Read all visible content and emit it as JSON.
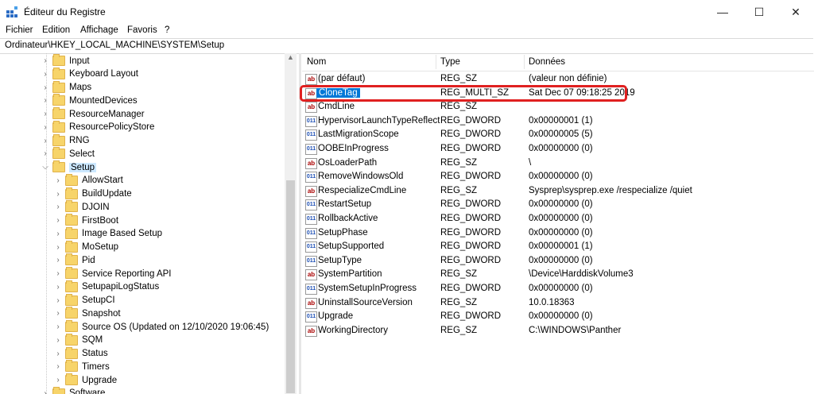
{
  "window": {
    "title": "Éditeur du Registre",
    "minimize_symbol": "—",
    "maximize_symbol": "☐",
    "close_symbol": "✕"
  },
  "menu": [
    "Fichier",
    "Edition",
    "Affichage",
    "Favoris",
    "?"
  ],
  "address": "Ordinateur\\HKEY_LOCAL_MACHINE\\SYSTEM\\Setup",
  "tree": {
    "items": [
      {
        "label": "Input",
        "level": 0,
        "expanded": false
      },
      {
        "label": "Keyboard Layout",
        "level": 0,
        "expanded": false
      },
      {
        "label": "Maps",
        "level": 0,
        "expanded": false
      },
      {
        "label": "MountedDevices",
        "level": 0,
        "expanded": false
      },
      {
        "label": "ResourceManager",
        "level": 0,
        "expanded": false
      },
      {
        "label": "ResourcePolicyStore",
        "level": 0,
        "expanded": false
      },
      {
        "label": "RNG",
        "level": 0,
        "expanded": false
      },
      {
        "label": "Select",
        "level": 0,
        "expanded": false
      },
      {
        "label": "Setup",
        "level": 0,
        "expanded": true,
        "selected": true
      },
      {
        "label": "AllowStart",
        "level": 1,
        "expanded": false
      },
      {
        "label": "BuildUpdate",
        "level": 1,
        "expanded": false
      },
      {
        "label": "DJOIN",
        "level": 1,
        "expanded": false
      },
      {
        "label": "FirstBoot",
        "level": 1,
        "expanded": false
      },
      {
        "label": "Image Based Setup",
        "level": 1,
        "expanded": false
      },
      {
        "label": "MoSetup",
        "level": 1,
        "expanded": false
      },
      {
        "label": "Pid",
        "level": 1,
        "expanded": false
      },
      {
        "label": "Service Reporting API",
        "level": 1,
        "expanded": false
      },
      {
        "label": "SetupapiLogStatus",
        "level": 1,
        "expanded": false
      },
      {
        "label": "SetupCI",
        "level": 1,
        "expanded": false
      },
      {
        "label": "Snapshot",
        "level": 1,
        "expanded": false
      },
      {
        "label": "Source OS (Updated on 12/10/2020 19:06:45)",
        "level": 1,
        "expanded": false
      },
      {
        "label": "SQM",
        "level": 1,
        "expanded": false
      },
      {
        "label": "Status",
        "level": 1,
        "expanded": false
      },
      {
        "label": "Timers",
        "level": 1,
        "expanded": false
      },
      {
        "label": "Upgrade",
        "level": 1,
        "expanded": false
      },
      {
        "label": "Software",
        "level": 0,
        "expanded": false
      }
    ]
  },
  "columns": {
    "name": "Nom",
    "type": "Type",
    "data": "Données"
  },
  "values": [
    {
      "name": "(par défaut)",
      "type": "REG_SZ",
      "data": "(valeur non définie)",
      "icon": "string-value-icon"
    },
    {
      "name": "CloneTag",
      "type": "REG_MULTI_SZ",
      "data": "Sat Dec 07 09:18:25 2019",
      "icon": "string-value-icon",
      "selected": true
    },
    {
      "name": "CmdLine",
      "type": "REG_SZ",
      "data": "",
      "icon": "string-value-icon"
    },
    {
      "name": "HypervisorLaunchTypeReflect",
      "type": "REG_DWORD",
      "data": "0x00000001 (1)",
      "icon": "binary-value-icon"
    },
    {
      "name": "LastMigrationScope",
      "type": "REG_DWORD",
      "data": "0x00000005 (5)",
      "icon": "binary-value-icon"
    },
    {
      "name": "OOBEInProgress",
      "type": "REG_DWORD",
      "data": "0x00000000 (0)",
      "icon": "binary-value-icon"
    },
    {
      "name": "OsLoaderPath",
      "type": "REG_SZ",
      "data": "\\",
      "icon": "string-value-icon"
    },
    {
      "name": "RemoveWindowsOld",
      "type": "REG_DWORD",
      "data": "0x00000000 (0)",
      "icon": "binary-value-icon"
    },
    {
      "name": "RespecializeCmdLine",
      "type": "REG_SZ",
      "data": "Sysprep\\sysprep.exe /respecialize /quiet",
      "icon": "string-value-icon"
    },
    {
      "name": "RestartSetup",
      "type": "REG_DWORD",
      "data": "0x00000000 (0)",
      "icon": "binary-value-icon"
    },
    {
      "name": "RollbackActive",
      "type": "REG_DWORD",
      "data": "0x00000000 (0)",
      "icon": "binary-value-icon"
    },
    {
      "name": "SetupPhase",
      "type": "REG_DWORD",
      "data": "0x00000000 (0)",
      "icon": "binary-value-icon"
    },
    {
      "name": "SetupSupported",
      "type": "REG_DWORD",
      "data": "0x00000001 (1)",
      "icon": "binary-value-icon"
    },
    {
      "name": "SetupType",
      "type": "REG_DWORD",
      "data": "0x00000000 (0)",
      "icon": "binary-value-icon"
    },
    {
      "name": "SystemPartition",
      "type": "REG_SZ",
      "data": "\\Device\\HarddiskVolume3",
      "icon": "string-value-icon"
    },
    {
      "name": "SystemSetupInProgress",
      "type": "REG_DWORD",
      "data": "0x00000000 (0)",
      "icon": "binary-value-icon"
    },
    {
      "name": "UninstallSourceVersion",
      "type": "REG_SZ",
      "data": "10.0.18363",
      "icon": "string-value-icon"
    },
    {
      "name": "Upgrade",
      "type": "REG_DWORD",
      "data": "0x00000000 (0)",
      "icon": "binary-value-icon"
    },
    {
      "name": "WorkingDirectory",
      "type": "REG_SZ",
      "data": "C:\\WINDOWS\\Panther",
      "icon": "string-value-icon"
    }
  ],
  "highlight_color": "#e02020",
  "selection_color": "#0078d7"
}
